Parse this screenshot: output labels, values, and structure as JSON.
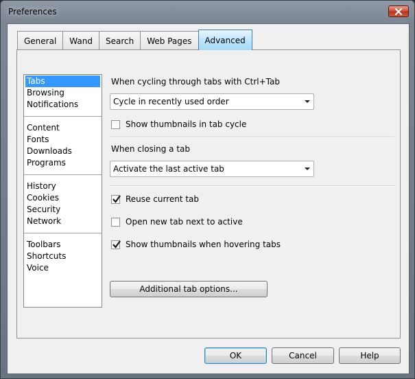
{
  "window": {
    "title": "Preferences"
  },
  "tabs": [
    {
      "label": "General"
    },
    {
      "label": "Wand"
    },
    {
      "label": "Search"
    },
    {
      "label": "Web Pages"
    },
    {
      "label": "Advanced"
    }
  ],
  "categories": [
    [
      "Tabs",
      "Browsing",
      "Notifications"
    ],
    [
      "Content",
      "Fonts",
      "Downloads",
      "Programs"
    ],
    [
      "History",
      "Cookies",
      "Security",
      "Network"
    ],
    [
      "Toolbars",
      "Shortcuts",
      "Voice"
    ]
  ],
  "cycling": {
    "label": "When cycling through tabs with Ctrl+Tab",
    "value": "Cycle in recently used order",
    "thumbnails_label": "Show thumbnails in tab cycle",
    "thumbnails_checked": false
  },
  "closing": {
    "label": "When closing a tab",
    "value": "Activate the last active tab"
  },
  "options": {
    "reuse_label": "Reuse current tab",
    "reuse_checked": true,
    "newtab_label": "Open new tab next to active",
    "newtab_checked": false,
    "hover_label": "Show thumbnails when hovering tabs",
    "hover_checked": true
  },
  "additional_label": "Additional tab options...",
  "buttons": {
    "ok": "OK",
    "cancel": "Cancel",
    "help": "Help"
  }
}
